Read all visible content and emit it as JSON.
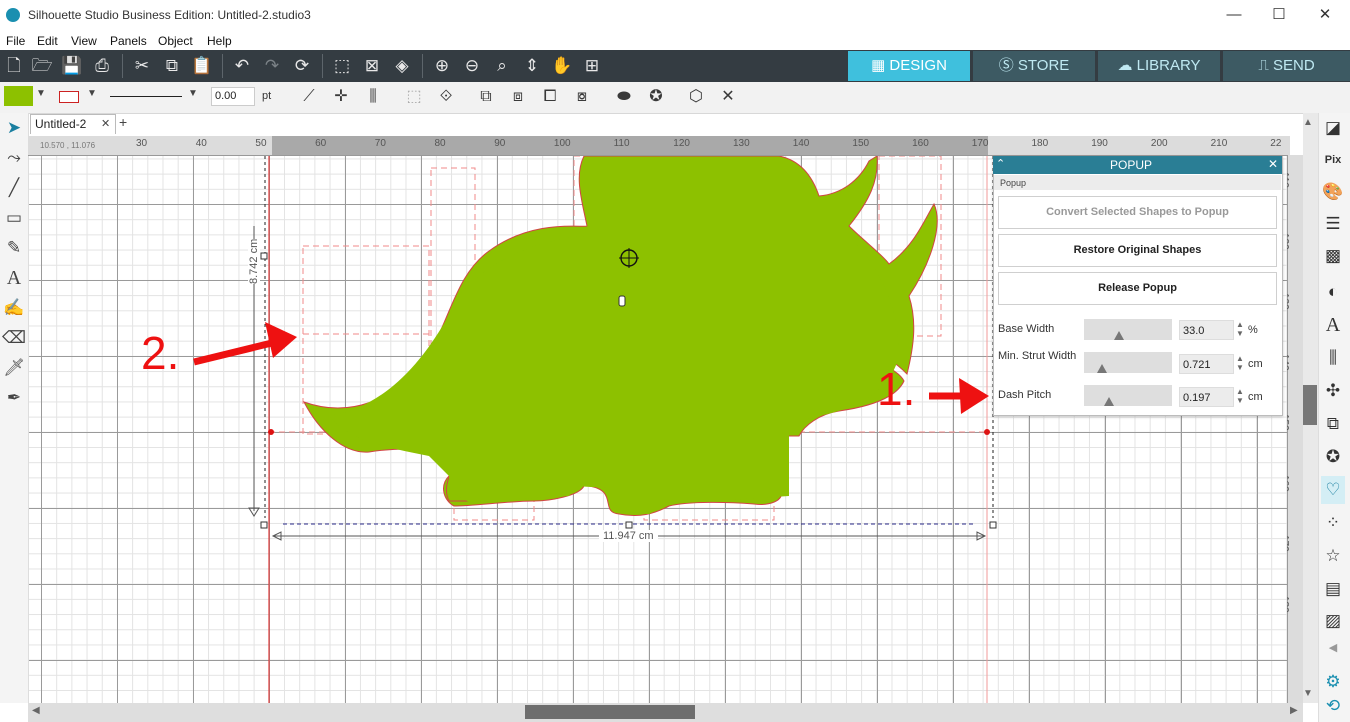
{
  "window": {
    "title": "Silhouette Studio Business Edition: Untitled-2.studio3",
    "minimize": "—",
    "maximize": "☐",
    "close": "✕"
  },
  "menu": [
    "File",
    "Edit",
    "View",
    "Panels",
    "Object",
    "Help"
  ],
  "nav_tabs": {
    "design": "DESIGN",
    "store": "STORE",
    "library": "LIBRARY",
    "send": "SEND"
  },
  "toolbar2": {
    "line_width_value": "0.00",
    "line_width_unit": "pt",
    "fill_color": "#8dc100",
    "line_color": "#cc2222"
  },
  "tabs": {
    "doc_tab": "Untitled-2",
    "doc_close": "✕",
    "add_tab": "+"
  },
  "ruler": {
    "coords": "10.570 , 11.076",
    "h_numbers": [
      "30",
      "40",
      "50",
      "60",
      "70",
      "80",
      "90",
      "100",
      "110",
      "120",
      "130",
      "140",
      "150",
      "160",
      "170",
      "180",
      "190",
      "200",
      "210",
      "22"
    ],
    "v_numbers": [
      "110",
      "120",
      "130",
      "140",
      "150",
      "160",
      "170",
      "180"
    ]
  },
  "canvas": {
    "height_label": "8.742 cm",
    "width_label": "11.947 cm",
    "annotation_2": "2.",
    "annotation_1": "1.",
    "shape_color": "#8dc100",
    "annotation_color": "#ee1111"
  },
  "popup": {
    "title": "POPUP",
    "close": "✕",
    "collapse": "⌃",
    "section": "Popup",
    "btn_convert": "Convert Selected Shapes to Popup",
    "btn_restore": "Restore Original Shapes",
    "btn_release": "Release Popup",
    "params": [
      {
        "label": "Base Width",
        "value": "33.0",
        "unit": "%",
        "slider_fraction": 0.33
      },
      {
        "label": "Min. Strut Width",
        "value": "0.721",
        "unit": "cm",
        "slider_fraction": 0.12
      },
      {
        "label": "Dash Pitch",
        "value": "0.197",
        "unit": "cm",
        "slider_fraction": 0.2
      }
    ]
  }
}
